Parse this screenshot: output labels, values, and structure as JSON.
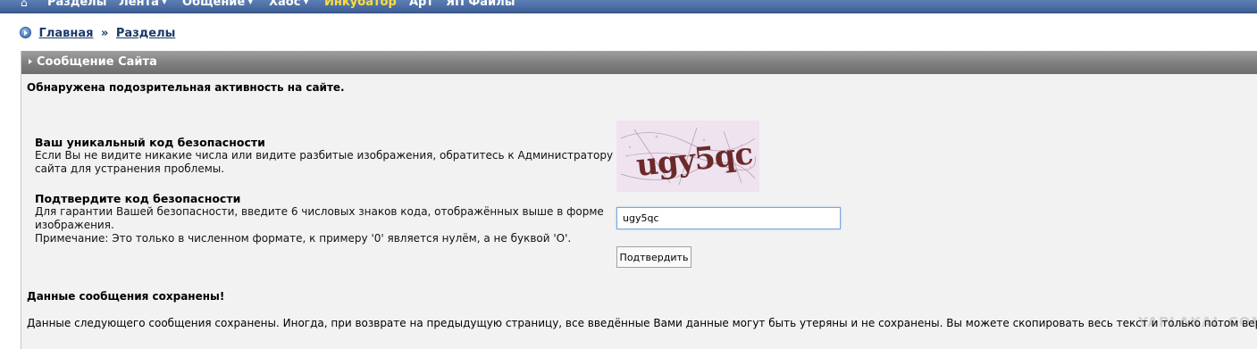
{
  "nav": {
    "home_icon": "home-icon",
    "items": [
      {
        "label": "Разделы",
        "dropdown": false
      },
      {
        "label": "Лента",
        "dropdown": true
      },
      {
        "label": "Общение",
        "dropdown": true
      },
      {
        "label": "Хаос",
        "dropdown": true
      },
      {
        "label": "Инкубатор",
        "dropdown": false
      },
      {
        "label": "Арт",
        "dropdown": false
      },
      {
        "label": "ЯП Файлы",
        "dropdown": false
      }
    ],
    "arrow_glyph": "▼",
    "active_color": "#ffde3a"
  },
  "breadcrumb": {
    "home": "Главная",
    "separator": "»",
    "current": "Разделы"
  },
  "panel": {
    "title": "Сообщение Сайта",
    "warning": "Обнаружена подозрительная активность на сайте.",
    "security_code": {
      "title": "Ваш уникальный код безопасности",
      "text": "Если Вы не видите никакие числа или видите разбитые изображения, обратитесь к Администратору сайта для устранения проблемы.",
      "captcha_text": "ugy5qc"
    },
    "confirm": {
      "title": "Подтвердите код безопасности",
      "text": "Для гарантии Вашей безопасности, введите 6 числовых знаков кода, отображённых выше в форме изображения.",
      "note": "Примечание: Это только в численном формате, к примеру '0' является нулём, а не буквой 'O'.",
      "input_value": "ugy5qc",
      "button_label": "Подтвердить"
    },
    "saved": {
      "title": "Данные сообщения сохранены!",
      "text": "Данные следующего сообщения сохранены. Иногда, при возврате на предыдущую страницу, все введённые Вами данные могут быть утеряны и не сохранены. Вы можете скопировать весь текст и только потом вернуть"
    },
    "watermark": "YAPLAKAL.COM"
  }
}
